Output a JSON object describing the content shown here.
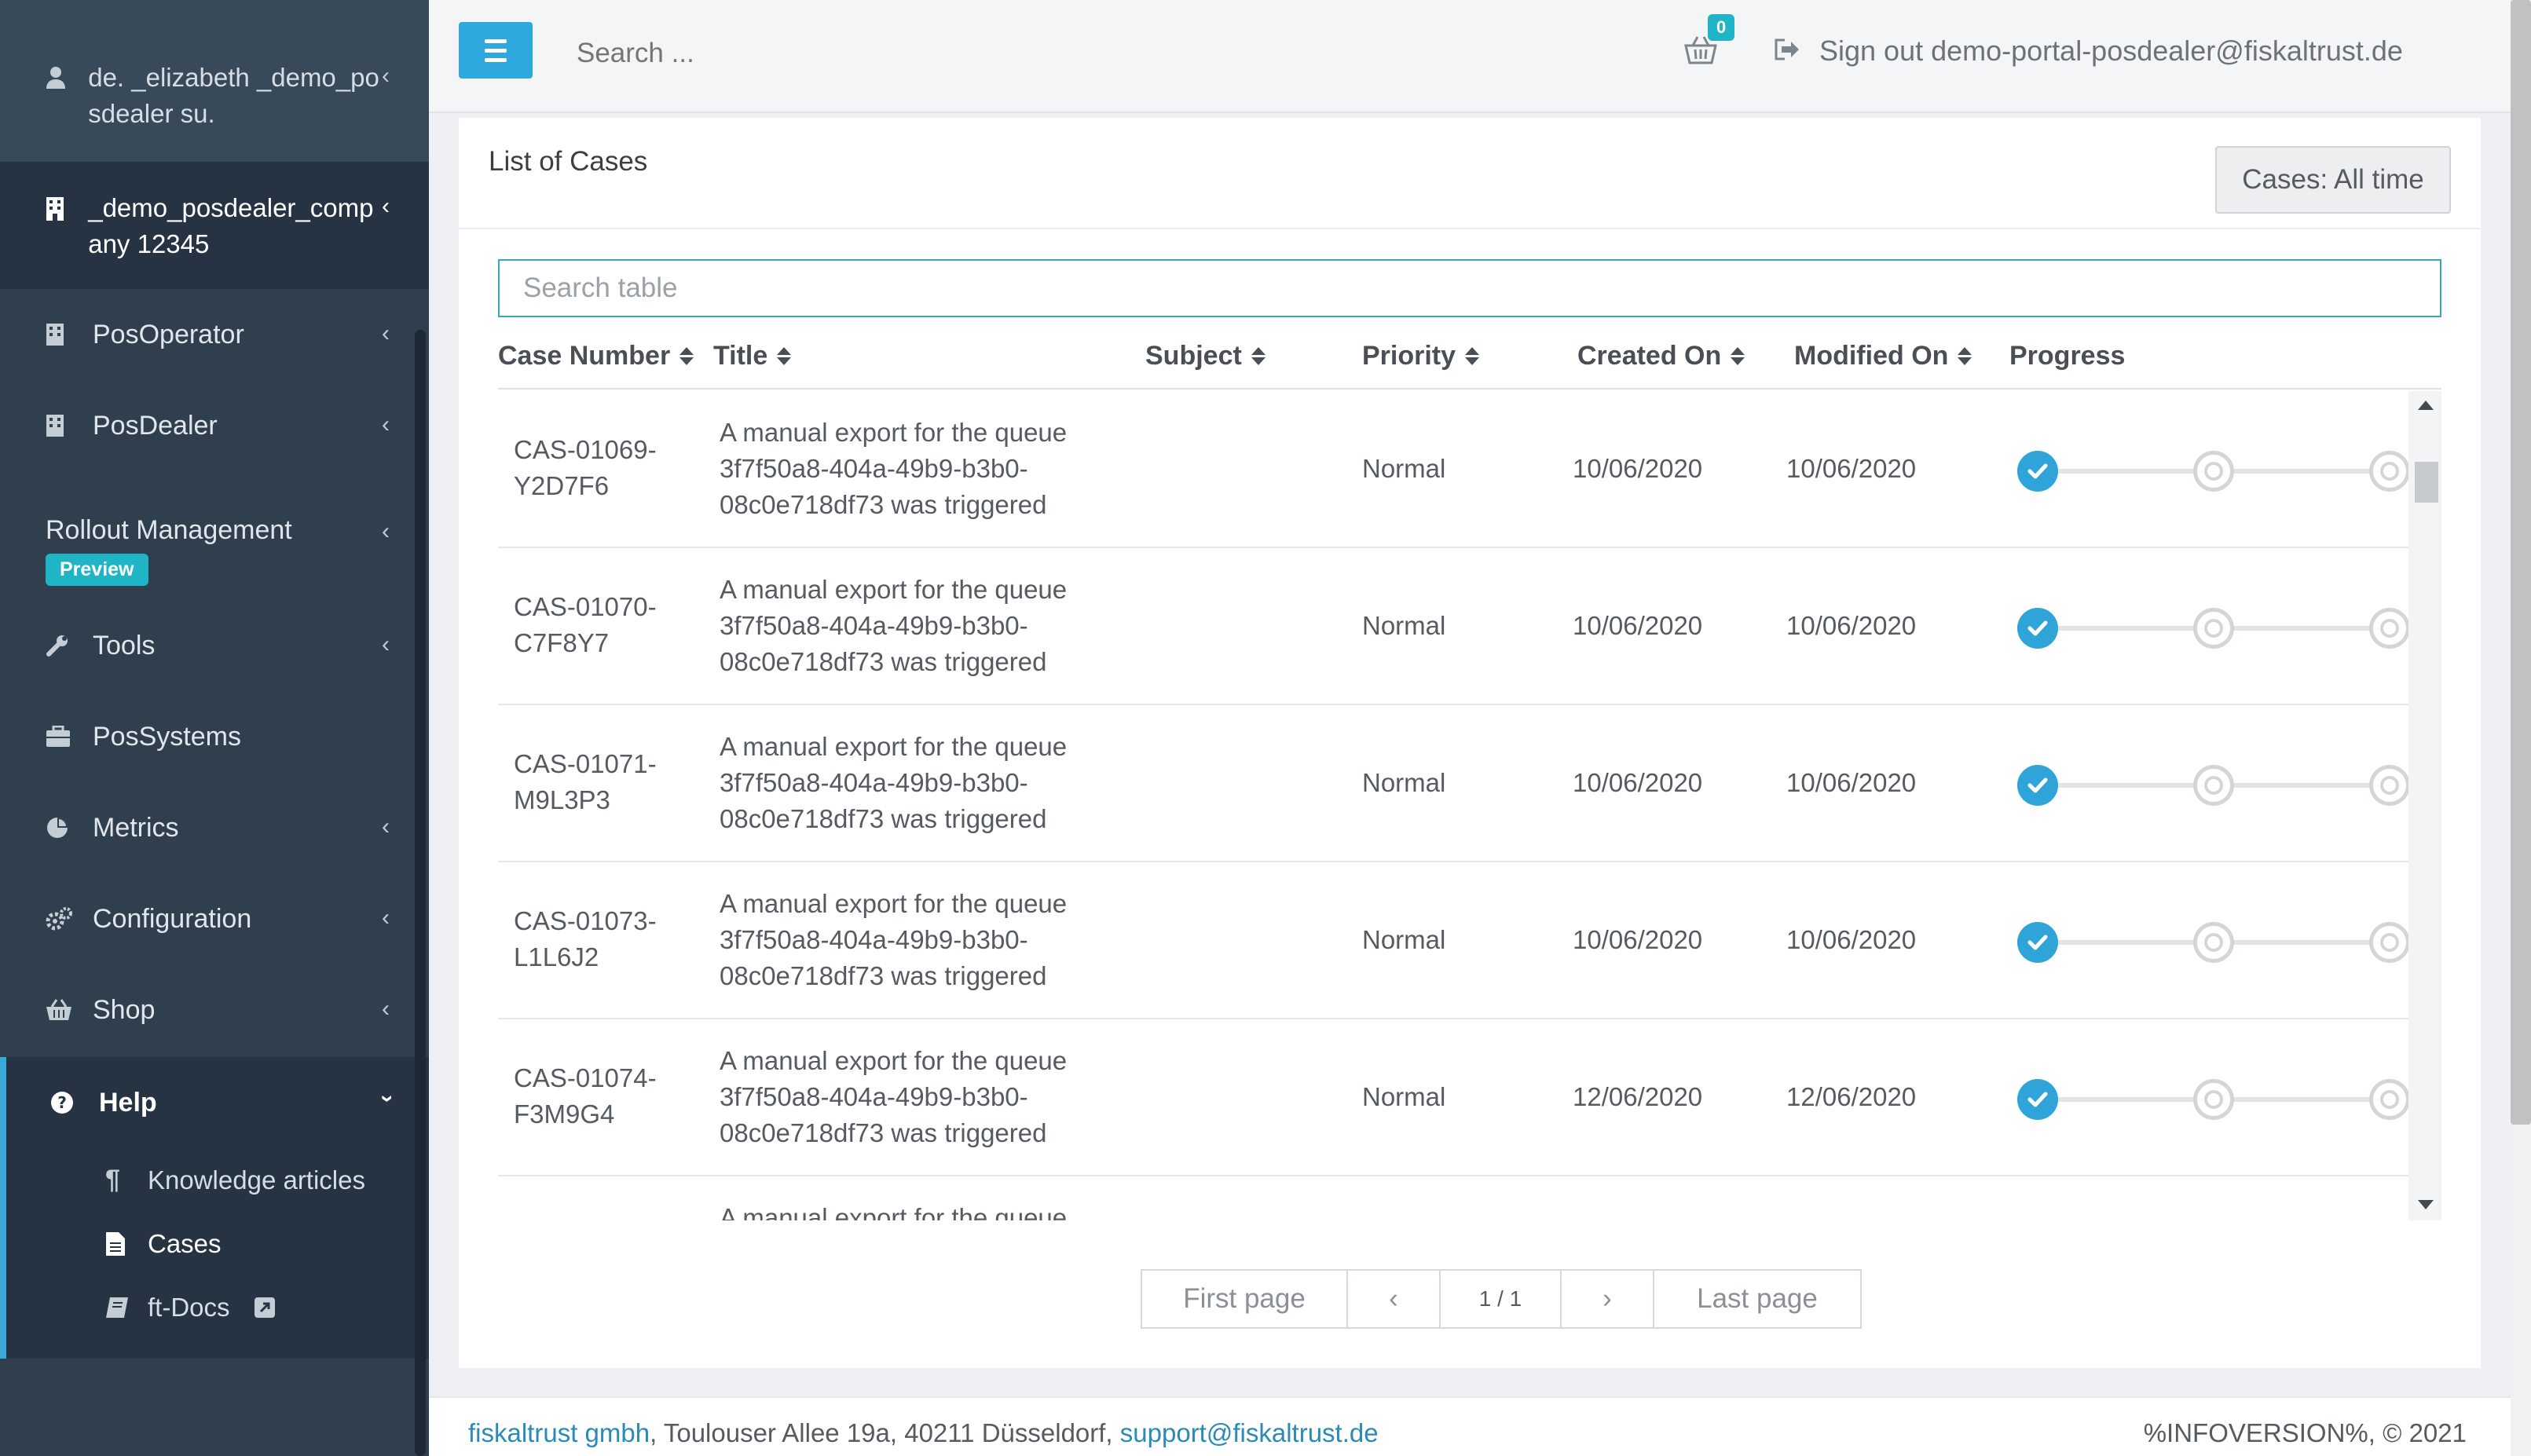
{
  "sidebar": {
    "user": "de. _elizabeth _demo_posdealer su.",
    "company": "_demo_posdealer_company 12345",
    "items": [
      {
        "label": "PosOperator"
      },
      {
        "label": "PosDealer"
      },
      {
        "label": "Rollout Management",
        "badge": "Preview"
      },
      {
        "label": "Tools"
      },
      {
        "label": "PosSystems"
      },
      {
        "label": "Metrics"
      },
      {
        "label": "Configuration"
      },
      {
        "label": "Shop"
      }
    ],
    "help": {
      "label": "Help",
      "children": [
        {
          "label": "Knowledge articles"
        },
        {
          "label": "Cases"
        },
        {
          "label": "ft-Docs"
        }
      ]
    }
  },
  "topbar": {
    "search_placeholder": "Search ...",
    "cart_count": "0",
    "signout": "Sign out demo-portal-posdealer@fiskaltrust.de"
  },
  "card": {
    "title": "List of Cases",
    "filter_button": "Cases: All time",
    "table_search_placeholder": "Search table",
    "columns": [
      "Case Number",
      "Title",
      "Subject",
      "Priority",
      "Created On",
      "Modified On",
      "Progress"
    ],
    "rows": [
      {
        "case_a": "CAS-01069-",
        "case_b": "Y2D7F6",
        "title_1": "A manual export for the queue",
        "title_2": "3f7f50a8-404a-49b9-b3b0-",
        "title_3": "08c0e718df73 was triggered",
        "subject": "",
        "priority": "Normal",
        "created": "10/06/2020",
        "modified": "10/06/2020",
        "progress_steps_done": 1
      },
      {
        "case_a": "CAS-01070-",
        "case_b": "C7F8Y7",
        "title_1": "A manual export for the queue",
        "title_2": "3f7f50a8-404a-49b9-b3b0-",
        "title_3": "08c0e718df73 was triggered",
        "subject": "",
        "priority": "Normal",
        "created": "10/06/2020",
        "modified": "10/06/2020",
        "progress_steps_done": 1
      },
      {
        "case_a": "CAS-01071-",
        "case_b": "M9L3P3",
        "title_1": "A manual export for the queue",
        "title_2": "3f7f50a8-404a-49b9-b3b0-",
        "title_3": "08c0e718df73 was triggered",
        "subject": "",
        "priority": "Normal",
        "created": "10/06/2020",
        "modified": "10/06/2020",
        "progress_steps_done": 1
      },
      {
        "case_a": "CAS-01073-",
        "case_b": "L1L6J2",
        "title_1": "A manual export for the queue",
        "title_2": "3f7f50a8-404a-49b9-b3b0-",
        "title_3": "08c0e718df73 was triggered",
        "subject": "",
        "priority": "Normal",
        "created": "10/06/2020",
        "modified": "10/06/2020",
        "progress_steps_done": 1
      },
      {
        "case_a": "CAS-01074-",
        "case_b": "F3M9G4",
        "title_1": "A manual export for the queue",
        "title_2": "3f7f50a8-404a-49b9-b3b0-",
        "title_3": "08c0e718df73 was triggered",
        "subject": "",
        "priority": "Normal",
        "created": "12/06/2020",
        "modified": "12/06/2020",
        "progress_steps_done": 1
      },
      {
        "case_a": "",
        "case_b": "",
        "title_1": "A manual export for the queue",
        "title_2": "",
        "title_3": "",
        "subject": "",
        "priority": "",
        "created": "",
        "modified": "",
        "progress_steps_done": 0
      }
    ],
    "progress_steps_total": 3,
    "pager": {
      "first": "First page",
      "prev": "‹",
      "page": "1 / 1",
      "next": "›",
      "last": "Last page"
    }
  },
  "footer": {
    "company": "fiskaltrust gmbh",
    "address": ", Toulouser Allee 19a, 40211 Düsseldorf, ",
    "email": "support@fiskaltrust.de",
    "version": "%INFOVERSION%, © 2021"
  },
  "colors": {
    "sidebar": "#303f4e",
    "accent": "#2ea8dd",
    "teal": "#1fb5c6"
  }
}
